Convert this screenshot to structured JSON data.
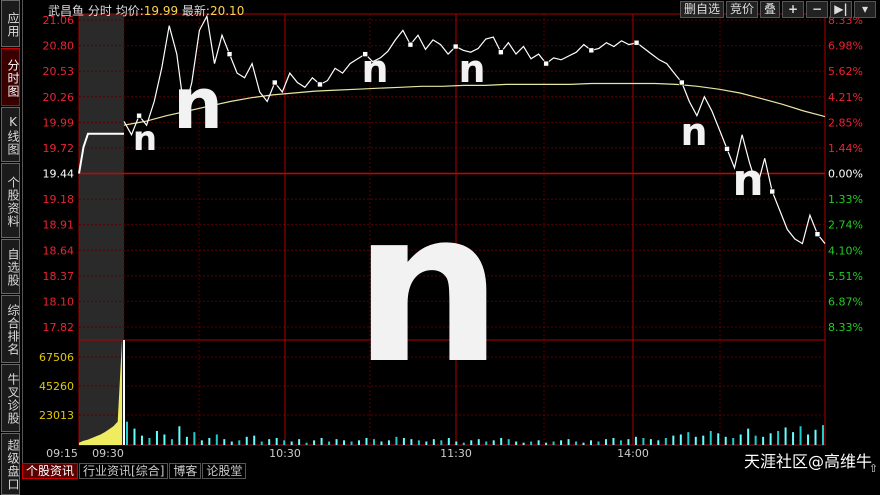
{
  "sidebar": {
    "tabs": [
      {
        "label": "应用",
        "active": false
      },
      {
        "label": "分时图",
        "active": true
      },
      {
        "label": "K线图",
        "active": false
      },
      {
        "label": "个股资料",
        "active": false
      },
      {
        "label": "自选股",
        "active": false
      },
      {
        "label": "综合排名",
        "active": false
      },
      {
        "label": "牛叉诊股",
        "active": false
      },
      {
        "label": "超级盘口",
        "active": false
      }
    ]
  },
  "header": {
    "stock_name": "武昌鱼",
    "mode": "分时",
    "avg_label": "均价:",
    "avg_value": "19.99",
    "latest_label": "最新:",
    "latest_value": "20.10"
  },
  "toolbar": {
    "delete_watch": "删自选",
    "auction": "竞价",
    "overlay": "叠",
    "plus_icon": "+",
    "minus_icon": "−",
    "step_icon": "▶|",
    "dropdown_icon": "▾"
  },
  "bottom_tabs": [
    {
      "label": "个股资讯",
      "active": true
    },
    {
      "label": "行业资讯[综合]",
      "active": false
    },
    {
      "label": "博客",
      "active": false
    },
    {
      "label": "论股堂",
      "active": false
    }
  ],
  "watermark": "天涯社区@高维牛",
  "status_corner": "⇧",
  "overlay_glyph": "n",
  "chart_data": {
    "type": "line",
    "prev_close": 19.44,
    "price_ticks": [
      "21.06",
      "20.80",
      "20.53",
      "20.26",
      "19.99",
      "19.72",
      "19.44",
      "19.18",
      "18.91",
      "18.64",
      "18.37",
      "18.10",
      "17.82"
    ],
    "pct_ticks": [
      "8.33%",
      "6.98%",
      "5.62%",
      "4.21%",
      "2.85%",
      "1.44%",
      "0.00%",
      "1.33%",
      "2.74%",
      "4.10%",
      "5.51%",
      "6.87%",
      "8.33%"
    ],
    "ylim": [
      17.82,
      21.06
    ],
    "volume_ticks": [
      "67506",
      "45260",
      "23013"
    ],
    "volume_max": 89752,
    "time_ticks": [
      "09:15",
      "09:30",
      "10:30",
      "11:30",
      "14:00"
    ],
    "preauction_price": [
      19.44,
      19.72,
      19.86,
      19.86,
      19.86,
      19.86,
      19.86,
      19.86,
      19.86,
      19.86,
      19.86
    ],
    "price": [
      19.99,
      19.85,
      20.05,
      19.95,
      20.2,
      20.55,
      21.0,
      20.7,
      20.1,
      20.4,
      20.95,
      21.1,
      20.6,
      20.9,
      20.7,
      20.5,
      20.45,
      20.6,
      20.3,
      20.2,
      20.4,
      20.3,
      20.5,
      20.4,
      20.35,
      20.45,
      20.38,
      20.42,
      20.55,
      20.5,
      20.6,
      20.65,
      20.7,
      20.62,
      20.66,
      20.73,
      20.85,
      20.95,
      20.8,
      20.9,
      20.75,
      20.85,
      20.8,
      20.7,
      20.78,
      20.74,
      20.72,
      20.76,
      20.86,
      20.88,
      20.72,
      20.82,
      20.7,
      20.78,
      20.65,
      20.7,
      20.6,
      20.66,
      20.64,
      20.68,
      20.72,
      20.8,
      20.74,
      20.76,
      20.82,
      20.78,
      20.84,
      20.8,
      20.82,
      20.76,
      20.7,
      20.64,
      20.6,
      20.5,
      20.4,
      20.2,
      20.05,
      20.25,
      20.1,
      19.9,
      19.7,
      19.5,
      19.85,
      19.55,
      19.3,
      19.6,
      19.25,
      19.05,
      18.85,
      18.75,
      18.7,
      19.0,
      18.8,
      18.7
    ],
    "avg_price": [
      19.95,
      19.99,
      20.05,
      20.1,
      20.15,
      20.2,
      20.24,
      20.27,
      20.29,
      20.31,
      20.32,
      20.33,
      20.34,
      20.35,
      20.36,
      20.36,
      20.37,
      20.37,
      20.38,
      20.38,
      20.38,
      20.38,
      20.39,
      20.39,
      20.39,
      20.39,
      20.38,
      20.36,
      20.33,
      20.29,
      20.23,
      20.17,
      20.1,
      20.04
    ],
    "volume_pre": [
      2000,
      3500,
      4500,
      6000,
      7500,
      9000,
      11000,
      13500,
      16000,
      20000,
      89752
    ],
    "volume": [
      20000,
      14000,
      8000,
      6000,
      12000,
      9000,
      5000,
      16000,
      7000,
      11000,
      4000,
      6000,
      9000,
      5000,
      3000,
      4000,
      7000,
      8000,
      3000,
      5000,
      6000,
      4000,
      3000,
      5000,
      2000,
      4000,
      6000,
      3000,
      5000,
      4000,
      3000,
      4000,
      6000,
      5000,
      3000,
      4000,
      7000,
      6000,
      5000,
      4000,
      3000,
      5000,
      4000,
      6000,
      3000,
      2000,
      4000,
      5000,
      3000,
      4000,
      6000,
      5000,
      3000,
      2000,
      3000,
      4000,
      2000,
      3000,
      4000,
      5000,
      3000,
      2000,
      4000,
      3000,
      5000,
      6000,
      4000,
      5000,
      7000,
      6000,
      5000,
      4000,
      6000,
      8000,
      9000,
      11000,
      7000,
      8000,
      12000,
      10000,
      7000,
      6000,
      9000,
      14000,
      8000,
      7000,
      10000,
      12000,
      15000,
      11000,
      16000,
      9000,
      13000,
      17000
    ]
  }
}
